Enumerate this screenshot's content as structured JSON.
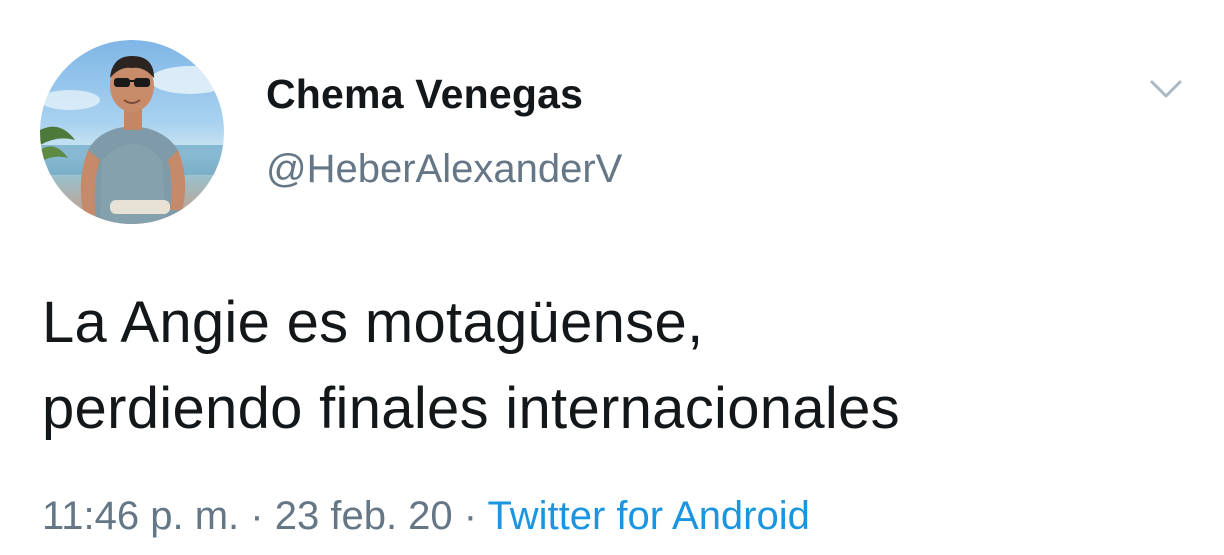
{
  "tweet": {
    "author": {
      "display_name": "Chema Venegas",
      "handle": "@HeberAlexanderV"
    },
    "text_lines": [
      "La Angie es motagüense,",
      "perdiendo finales internacionales"
    ],
    "time": "11:46 p. m.",
    "separator": "·",
    "date": "23 feb. 20",
    "source": "Twitter for Android"
  },
  "icons": {
    "menu": "chevron-down-icon",
    "avatar": "profile-photo"
  },
  "colors": {
    "text": "#14171a",
    "secondary": "#657786",
    "link": "#1b95e0"
  }
}
